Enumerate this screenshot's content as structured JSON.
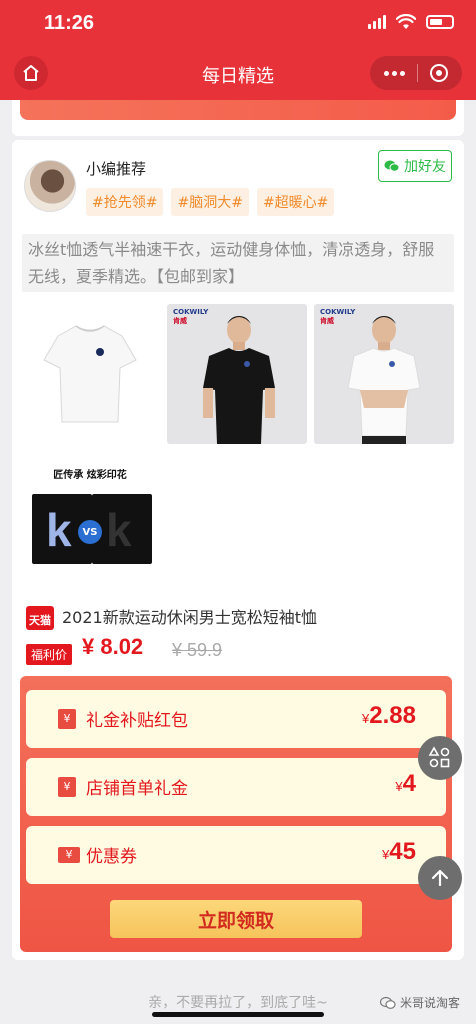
{
  "status_bar": {
    "time": "11:26"
  },
  "nav": {
    "title": "每日精选"
  },
  "post": {
    "editor_name": "小编推荐",
    "add_friend_label": "加好友",
    "tags": [
      "#抢先领#",
      "#脑洞大#",
      "#超暖心#"
    ],
    "description": "冰丝t恤透气半袖速干衣，运动健身体恤，清凉透身，舒服无线，夏季精选。【包邮到家】",
    "images": [
      {
        "kind": "white-tshirt"
      },
      {
        "kind": "model-black-tshirt",
        "brand": "COKWILY",
        "brand_cn": "肯威"
      },
      {
        "kind": "model-white-tshirt",
        "brand": "COKWILY",
        "brand_cn": "肯威"
      },
      {
        "kind": "print-comparison",
        "title": "匠传承 炫彩印花",
        "vs": "VS"
      }
    ]
  },
  "product": {
    "platform_badge": "天猫",
    "title": "2021新款运动休闲男士宽松短袖t恤",
    "price_badge": "福利价",
    "price": "¥ 8.02",
    "original_price": "¥ 59.9"
  },
  "coupons": [
    {
      "icon": "gift-icon",
      "label": "礼金补贴红包",
      "currency": "¥",
      "value": "2.88"
    },
    {
      "icon": "gift-icon",
      "label": "店铺首单礼金",
      "currency": "¥",
      "value": "4"
    },
    {
      "icon": "ticket-icon",
      "label": "优惠券",
      "currency": "¥",
      "value": "45"
    }
  ],
  "claim_button": "立即领取",
  "footer": {
    "end_text": "亲，不要再拉了，到底了哇~",
    "watermark": "米哥说淘客"
  },
  "colors": {
    "header": "#e8323a",
    "accent_red": "#e3181f",
    "tag_orange": "#f08a2a",
    "wechat_green": "#2dbb47",
    "coupon_bg": "#fffbe2",
    "button_gold": "#f6c45c"
  }
}
